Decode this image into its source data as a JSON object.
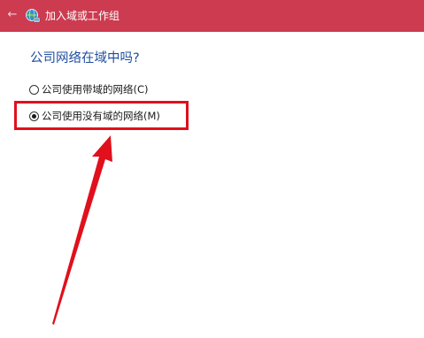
{
  "window": {
    "title": "加入域或工作组",
    "back_icon": "back-arrow-icon",
    "app_icon": "globe-network-icon",
    "titlebar_color": "#cc3b4f"
  },
  "main": {
    "heading": "公司网络在域中吗?",
    "heading_color": "#1f4e9e",
    "options": [
      {
        "label": "公司使用带域的网络(C)",
        "selected": false
      },
      {
        "label": "公司使用没有域的网络(M)",
        "selected": true
      }
    ]
  },
  "annotation": {
    "highlight_color": "#e0101c",
    "arrow_color": "#e0101c"
  }
}
